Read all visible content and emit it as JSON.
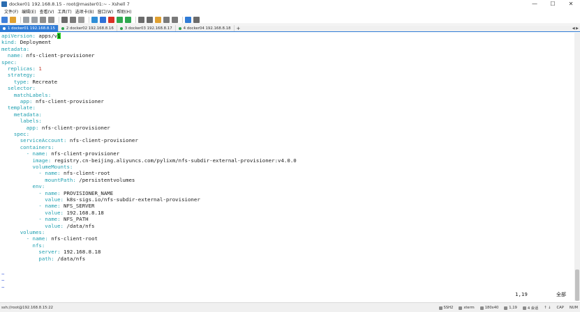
{
  "window": {
    "title": "docker01 192.168.8.15 - root@master01:~ - Xshell 7",
    "controls": {
      "minimize": "—",
      "maximize": "☐",
      "close": "✕"
    }
  },
  "menu": [
    "文件(F)",
    "编辑(E)",
    "查看(V)",
    "工具(T)",
    "选项卡(B)",
    "窗口(W)",
    "帮助(H)"
  ],
  "toolbar_icons": [
    {
      "name": "new-session-icon",
      "color": "#3f7fd8"
    },
    {
      "name": "open-folder-icon",
      "color": "#e0a030"
    },
    {
      "name": "disconnect-icon",
      "color": "#9aa0a6"
    },
    {
      "name": "reconnect-icon",
      "color": "#9aa0a6"
    },
    {
      "name": "copy-icon",
      "color": "#8e8e8e"
    },
    {
      "name": "paste-icon",
      "color": "#8e8e8e"
    },
    {
      "name": "find-icon",
      "color": "#6b6b6b"
    },
    {
      "name": "print-icon",
      "color": "#7a7a7a"
    },
    {
      "name": "properties-icon",
      "color": "#9a9a9a"
    },
    {
      "name": "globe-icon",
      "color": "#2f8ed6"
    },
    {
      "name": "font-icon",
      "color": "#2f6fd6"
    },
    {
      "name": "color-scheme-icon",
      "color": "#d93025"
    },
    {
      "name": "xftp-icon",
      "color": "#2fa84f"
    },
    {
      "name": "xftp2-icon",
      "color": "#2fa84f"
    },
    {
      "name": "keyboard-icon",
      "color": "#6b6b6b"
    },
    {
      "name": "lock-icon",
      "color": "#6b6b6b"
    },
    {
      "name": "compose-icon",
      "color": "#e0a030"
    },
    {
      "name": "script-icon",
      "color": "#7a7a7a"
    },
    {
      "name": "layout-icon",
      "color": "#7a7a7a"
    },
    {
      "name": "help-icon",
      "color": "#2f7bd6"
    },
    {
      "name": "lock2-icon",
      "color": "#6b6b6b"
    }
  ],
  "tabs": [
    {
      "label": "1 docker01 192.168.8.15",
      "active": true
    },
    {
      "label": "2 docker02 192.168.8.16",
      "active": false
    },
    {
      "label": "3 docker03 192.168.8.17",
      "active": false
    },
    {
      "label": "4 docker04 192.168.8.18",
      "active": false
    }
  ],
  "tab_add": "+",
  "tab_arrows": "◀ ▶",
  "terminal": {
    "lines": [
      {
        "indent": "",
        "key": "apiVersion",
        "sep": ": ",
        "value": "apps/v",
        "cursor": "1"
      },
      {
        "indent": "",
        "key": "kind",
        "sep": ": ",
        "value": "Deployment"
      },
      {
        "indent": "",
        "key": "metadata",
        "sep": ":",
        "value": ""
      },
      {
        "indent": "  ",
        "key": "name",
        "sep": ": ",
        "value": "nfs-client-provisioner"
      },
      {
        "indent": "",
        "key": "spec",
        "sep": ":",
        "value": ""
      },
      {
        "indent": "  ",
        "key": "replicas",
        "sep": ": ",
        "num": "1"
      },
      {
        "indent": "  ",
        "key": "strategy",
        "sep": ":",
        "value": ""
      },
      {
        "indent": "    ",
        "key": "type",
        "sep": ": ",
        "value": "Recreate"
      },
      {
        "indent": "  ",
        "key": "selector",
        "sep": ":",
        "value": ""
      },
      {
        "indent": "    ",
        "key": "matchLabels",
        "sep": ":",
        "value": ""
      },
      {
        "indent": "      ",
        "key": "app",
        "sep": ": ",
        "value": "nfs-client-provisioner"
      },
      {
        "indent": "  ",
        "key": "template",
        "sep": ":",
        "value": ""
      },
      {
        "indent": "    ",
        "key": "metadata",
        "sep": ":",
        "value": ""
      },
      {
        "indent": "      ",
        "key": "labels",
        "sep": ":",
        "value": ""
      },
      {
        "indent": "        ",
        "key": "app",
        "sep": ": ",
        "value": "nfs-client-provisioner"
      },
      {
        "indent": "    ",
        "key": "spec",
        "sep": ":",
        "value": ""
      },
      {
        "indent": "      ",
        "key": "serviceAccount",
        "sep": ": ",
        "value": "nfs-client-provisioner"
      },
      {
        "indent": "      ",
        "key": "containers",
        "sep": ":",
        "value": ""
      },
      {
        "indent": "        ",
        "dash": "- ",
        "key": "name",
        "sep": ": ",
        "value": "nfs-client-provisioner"
      },
      {
        "indent": "          ",
        "key": "image",
        "sep": ": ",
        "value": "registry.cn-beijing.aliyuncs.com/pylixm/nfs-subdir-external-provisioner:v4.0.0"
      },
      {
        "indent": "          ",
        "key": "volumeMounts",
        "sep": ":",
        "value": ""
      },
      {
        "indent": "            ",
        "dash": "- ",
        "key": "name",
        "sep": ": ",
        "value": "nfs-client-root"
      },
      {
        "indent": "              ",
        "key": "mountPath",
        "sep": ": ",
        "value": "/persistentvolumes"
      },
      {
        "indent": "          ",
        "key": "env",
        "sep": ":",
        "value": ""
      },
      {
        "indent": "            ",
        "dash": "- ",
        "key": "name",
        "sep": ": ",
        "value": "PROVISIONER_NAME"
      },
      {
        "indent": "              ",
        "key": "value",
        "sep": ": ",
        "value": "k8s-sigs.io/nfs-subdir-external-provisioner"
      },
      {
        "indent": "            ",
        "dash": "- ",
        "key": "name",
        "sep": ": ",
        "value": "NFS_SERVER"
      },
      {
        "indent": "              ",
        "key": "value",
        "sep": ": ",
        "value": "192.168.8.18"
      },
      {
        "indent": "            ",
        "dash": "- ",
        "key": "name",
        "sep": ": ",
        "value": "NFS_PATH"
      },
      {
        "indent": "              ",
        "key": "value",
        "sep": ": ",
        "value": "/data/nfs"
      },
      {
        "indent": "      ",
        "key": "volumes",
        "sep": ":",
        "value": ""
      },
      {
        "indent": "        ",
        "dash": "- ",
        "key": "name",
        "sep": ": ",
        "value": "nfs-client-root"
      },
      {
        "indent": "          ",
        "key": "nfs",
        "sep": ":",
        "value": ""
      },
      {
        "indent": "            ",
        "key": "server",
        "sep": ": ",
        "value": "192.168.8.18"
      },
      {
        "indent": "            ",
        "key": "path",
        "sep": ": ",
        "value": "/data/nfs"
      }
    ],
    "tildes": [
      "~",
      "~",
      "~"
    ],
    "cursor_position": "1,19",
    "scroll_mode": "全部"
  },
  "status": {
    "session": "ssh://root@192.168.8.15:22",
    "protocol": "SSH2",
    "term": "xterm",
    "size": "180x40",
    "cursor": "1,19",
    "sessions": "4 会话",
    "cap": "CAP",
    "num": "NUM"
  }
}
